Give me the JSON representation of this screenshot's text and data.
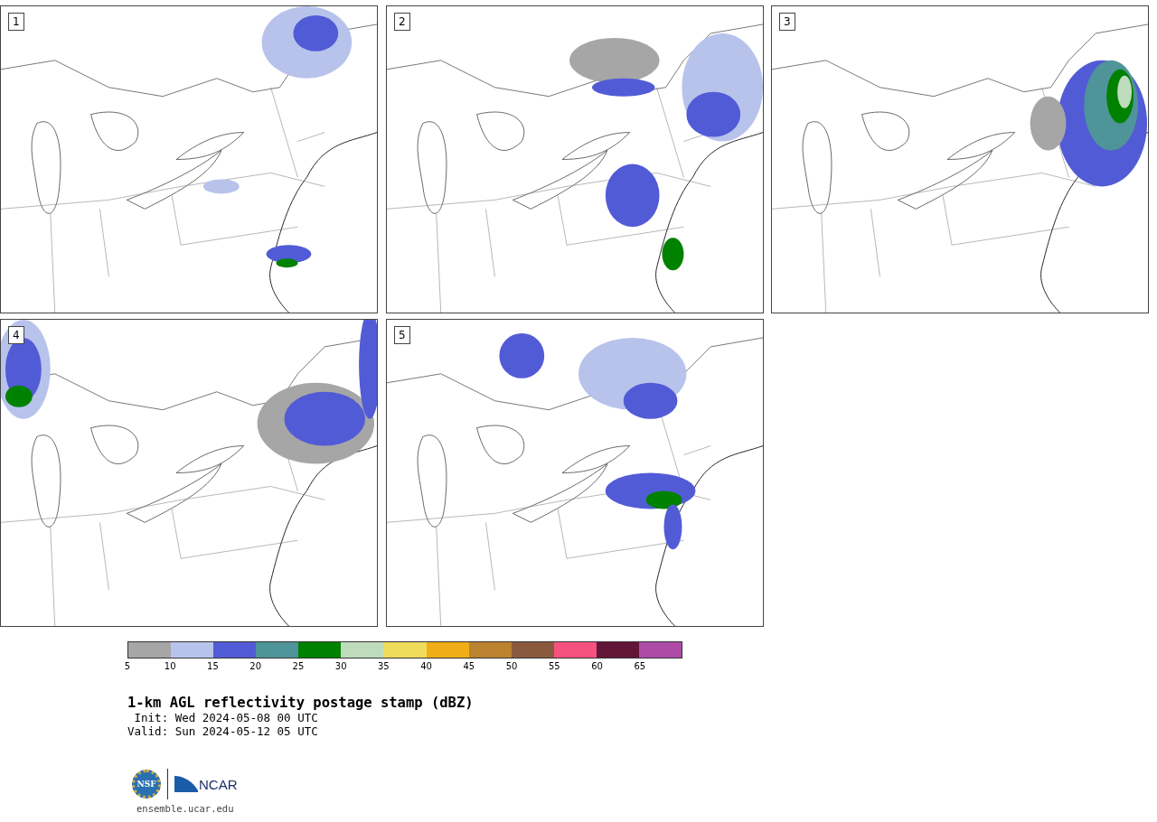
{
  "panels": [
    {
      "label": "1"
    },
    {
      "label": "2"
    },
    {
      "label": "3"
    },
    {
      "label": "4"
    },
    {
      "label": "5"
    }
  ],
  "colorbar": {
    "segments": [
      {
        "color": "#a6a6a6"
      },
      {
        "color": "#b8c3ec"
      },
      {
        "color": "#525bd6"
      },
      {
        "color": "#4f9499"
      },
      {
        "color": "#018100"
      },
      {
        "color": "#bedcbc"
      },
      {
        "color": "#efdc5a"
      },
      {
        "color": "#efad17"
      },
      {
        "color": "#bb822f"
      },
      {
        "color": "#8a5a3f"
      },
      {
        "color": "#f5527f"
      },
      {
        "color": "#621638"
      },
      {
        "color": "#ad4ba6"
      }
    ],
    "ticks": [
      "5",
      "10",
      "15",
      "20",
      "25",
      "30",
      "35",
      "40",
      "45",
      "50",
      "55",
      "60",
      "65"
    ]
  },
  "title": "1-km AGL reflectivity postage stamp (dBZ)",
  "init": " Init: Wed 2024-05-08 00 UTC",
  "valid": "Valid: Sun 2024-05-12 05 UTC",
  "logo": {
    "left": "NSF",
    "right": "NCAR"
  },
  "footer": "ensemble.ucar.edu"
}
